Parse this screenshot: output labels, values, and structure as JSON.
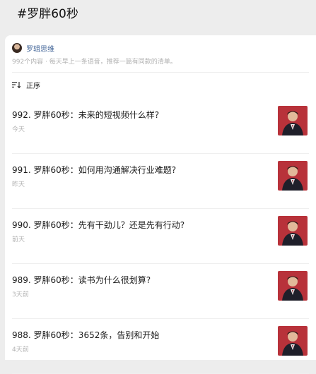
{
  "page": {
    "title": "#罗胖60秒"
  },
  "account": {
    "name": "罗辑思维",
    "description": "992个内容 · 每天早上一条语音，推荐一篇有同款的清单。"
  },
  "sort": {
    "label": "正序",
    "icon": "sort-icon"
  },
  "episodes": [
    {
      "title": "992. 罗胖60秒：未来的短视频什么样?",
      "date": "今天"
    },
    {
      "title": "991. 罗胖60秒：如何用沟通解决行业难题?",
      "date": "昨天"
    },
    {
      "title": "990. 罗胖60秒：先有干劲儿？还是先有行动?",
      "date": "前天"
    },
    {
      "title": "989. 罗胖60秒：读书为什么很划算?",
      "date": "3天前"
    },
    {
      "title": "988. 罗胖60秒：3652条，告别和开始",
      "date": "4天前"
    }
  ],
  "colors": {
    "thumb_bg": "#b8323a",
    "link": "#4a6b9c"
  }
}
